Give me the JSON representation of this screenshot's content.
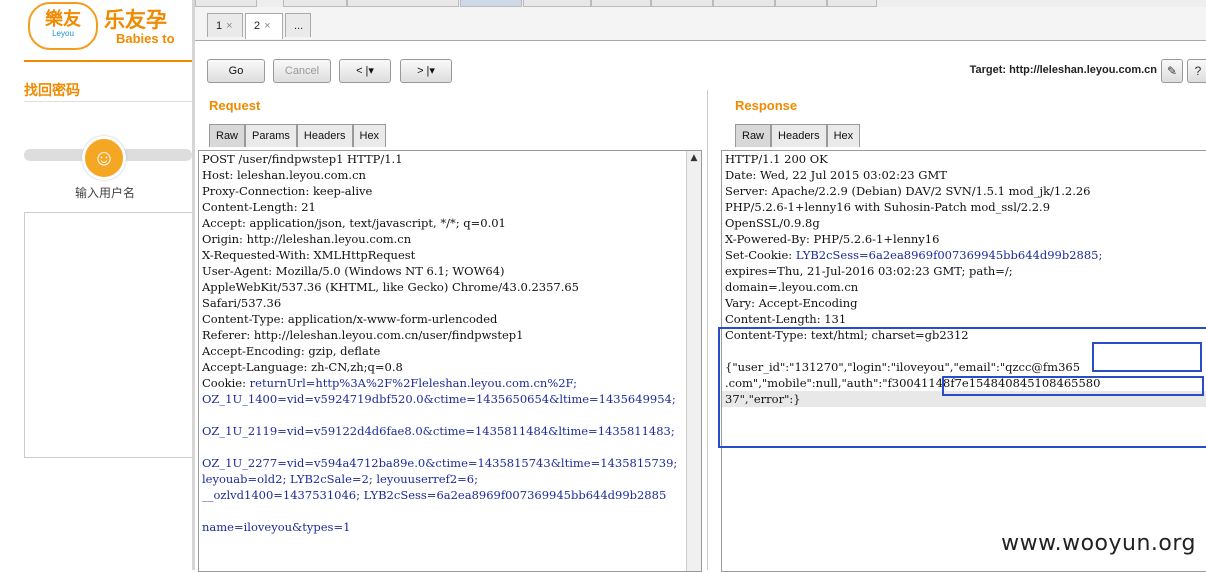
{
  "site": {
    "logo_cn": "乐友孕",
    "logo_badge": "樂友",
    "logo_badge_sub": "Leyou",
    "logo_en": "Babies to",
    "find_title": "找回密码",
    "step_label": "输入用户名"
  },
  "tabs": {
    "tab1": "1",
    "tab2": "2",
    "more": "...",
    "close": "×"
  },
  "toolbar": {
    "go": "Go",
    "cancel": "Cancel",
    "back": "< |▾",
    "forward": "> |▾",
    "target_label": "Target: http://leleshan.leyou.com.cn",
    "edit_icon": "✎",
    "help_icon": "?"
  },
  "request": {
    "title": "Request",
    "tabs": [
      "Raw",
      "Params",
      "Headers",
      "Hex"
    ],
    "lines": [
      {
        "k": "POST /user/findpwstep1 HTTP/1.1",
        "v": ""
      },
      {
        "k": "Host: leleshan.leyou.com.cn",
        "v": ""
      },
      {
        "k": "Proxy-Connection: keep-alive",
        "v": ""
      },
      {
        "k": "Content-Length: 21",
        "v": ""
      },
      {
        "k": "Accept: application/json, text/javascript, */*; q=0.01",
        "v": ""
      },
      {
        "k": "Origin: http://leleshan.leyou.com.cn",
        "v": ""
      },
      {
        "k": "X-Requested-With: XMLHttpRequest",
        "v": ""
      },
      {
        "k": "User-Agent: Mozilla/5.0 (Windows NT 6.1; WOW64)",
        "v": ""
      },
      {
        "k": "AppleWebKit/537.36 (KHTML, like Gecko) Chrome/43.0.2357.65",
        "v": ""
      },
      {
        "k": "Safari/537.36",
        "v": ""
      },
      {
        "k": "Content-Type: application/x-www-form-urlencoded",
        "v": ""
      },
      {
        "k": "Referer: http://leleshan.leyou.com.cn/user/findpwstep1",
        "v": ""
      },
      {
        "k": "Accept-Encoding: gzip, deflate",
        "v": ""
      },
      {
        "k": "Accept-Language: zh-CN,zh;q=0.8",
        "v": ""
      },
      {
        "k": "Cookie: ",
        "v": "returnUrl=http%3A%2F%2Fleleshan.leyou.com.cn%2F;"
      },
      {
        "k": "",
        "v": "OZ_1U_1400=vid=v5924719dbf520.0&ctime=1435650654&ltime=1435649954;"
      },
      {
        "k": "",
        "v": ""
      },
      {
        "k": "",
        "v": "OZ_1U_2119=vid=v59122d4d6fae8.0&ctime=1435811484&ltime=1435811483;"
      },
      {
        "k": "",
        "v": ""
      },
      {
        "k": "",
        "v": "OZ_1U_2277=vid=v594a4712ba89e.0&ctime=1435815743&ltime=1435815739;"
      },
      {
        "k": "",
        "v": "leyouab=old2; LYB2cSale=2; leyouuserref2=6;"
      },
      {
        "k": "",
        "v": "__ozlvd1400=1437531046; LYB2cSess=6a2ea8969f007369945bb644d99b2885"
      },
      {
        "k": "",
        "v": ""
      },
      {
        "k": "",
        "v": "name=iloveyou&types=1"
      }
    ]
  },
  "response": {
    "title": "Response",
    "tabs": [
      "Raw",
      "Headers",
      "Hex"
    ],
    "lines": [
      {
        "k": "HTTP/1.1 200 OK",
        "v": ""
      },
      {
        "k": "Date: Wed, 22 Jul 2015 03:02:23 GMT",
        "v": ""
      },
      {
        "k": "Server: Apache/2.2.9 (Debian) DAV/2 SVN/1.5.1 mod_jk/1.2.26",
        "v": ""
      },
      {
        "k": "PHP/5.2.6-1+lenny16 with Suhosin-Patch mod_ssl/2.2.9",
        "v": ""
      },
      {
        "k": "OpenSSL/0.9.8g",
        "v": ""
      },
      {
        "k": "X-Powered-By: PHP/5.2.6-1+lenny16",
        "v": ""
      },
      {
        "k": "Set-Cookie: ",
        "v": "LYB2cSess=6a2ea8969f007369945bb644d99b2885;"
      },
      {
        "k": "expires=Thu, 21-Jul-2016 03:02:23 GMT; path=/;",
        "v": ""
      },
      {
        "k": "domain=.leyou.com.cn",
        "v": ""
      },
      {
        "k": "Vary: Accept-Encoding",
        "v": ""
      },
      {
        "k": "Content-Length: 131",
        "v": ""
      },
      {
        "k": "Content-Type: text/html; charset=gb2312",
        "v": ""
      },
      {
        "k": "",
        "v": ""
      },
      {
        "k": "{\"user_id\":\"131270\",\"login\":\"iloveyou\",\"email\":\"qzcc@fm365",
        "v": ""
      },
      {
        "k": ".com\",\"mobile\":null,\"auth\":\"f30041148f7e154840845108465580",
        "v": ""
      },
      {
        "k": "37\",\"error\":}",
        "v": ""
      }
    ]
  },
  "watermark": "www.wooyun.org",
  "colors": {
    "accent": "#f08a00",
    "highlight_box": "#2a4cc7",
    "value_blue": "#1c2b9a"
  }
}
